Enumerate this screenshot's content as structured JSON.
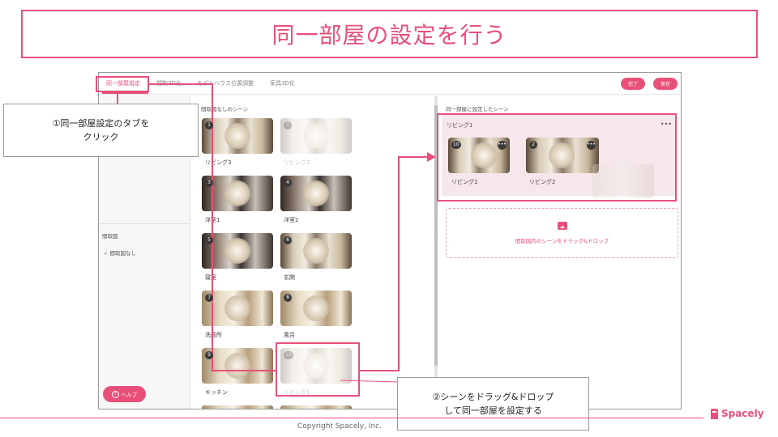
{
  "slide": {
    "title": "同一部屋の設定を行う",
    "footer": "Copyright Spacely, Inc.",
    "brand": "Spacely"
  },
  "tabs": [
    {
      "label": "同一部屋設定",
      "active": true
    },
    {
      "label": "間取3D化",
      "active": false
    },
    {
      "label": "モデルハウス位置調整",
      "active": false
    },
    {
      "label": "家具3D化",
      "active": false
    }
  ],
  "header_buttons": {
    "done": "完了",
    "save": "保存"
  },
  "sidebar": {
    "floorplan_heading": "間取図",
    "floorplan_option": "✓ 間取図なし",
    "help_icon": "?",
    "help_label": "ヘルプ"
  },
  "left_panel": {
    "heading": "間取図なしのシーン",
    "scenes": [
      {
        "number": "1",
        "label": "リビング3",
        "faded": false
      },
      {
        "number": "2",
        "label": "リビング2",
        "faded": true
      },
      {
        "number": "3",
        "label": "洋室1",
        "faded": false
      },
      {
        "number": "4",
        "label": "洋室2",
        "faded": false
      },
      {
        "number": "5",
        "label": "寝室",
        "faded": false
      },
      {
        "number": "6",
        "label": "玄関",
        "faded": false
      },
      {
        "number": "7",
        "label": "洗面所",
        "faded": false
      },
      {
        "number": "8",
        "label": "風呂",
        "faded": false
      },
      {
        "number": "9",
        "label": "キッチン",
        "faded": false
      },
      {
        "number": "10",
        "label": "リビング1",
        "faded": true
      }
    ]
  },
  "right_panel": {
    "heading": "同一部屋に設定したシーン",
    "group": {
      "title": "リビング1",
      "menu": "•••",
      "scenes": [
        {
          "number": "10",
          "label": "リビング1"
        },
        {
          "number": "2",
          "label": "リビング2"
        }
      ]
    },
    "drop_zone_text": "間取図内のシーンをドラッグ&ドロップ"
  },
  "callouts": {
    "step1": "①同一部屋設定のタブを\nクリック",
    "step2": "②シーンをドラッグ&ドロップ\nして同一部屋を設定する"
  },
  "icons": {
    "more": "•••"
  },
  "colors": {
    "accent": "#e8507a",
    "group_bg": "#f6e7ec"
  }
}
